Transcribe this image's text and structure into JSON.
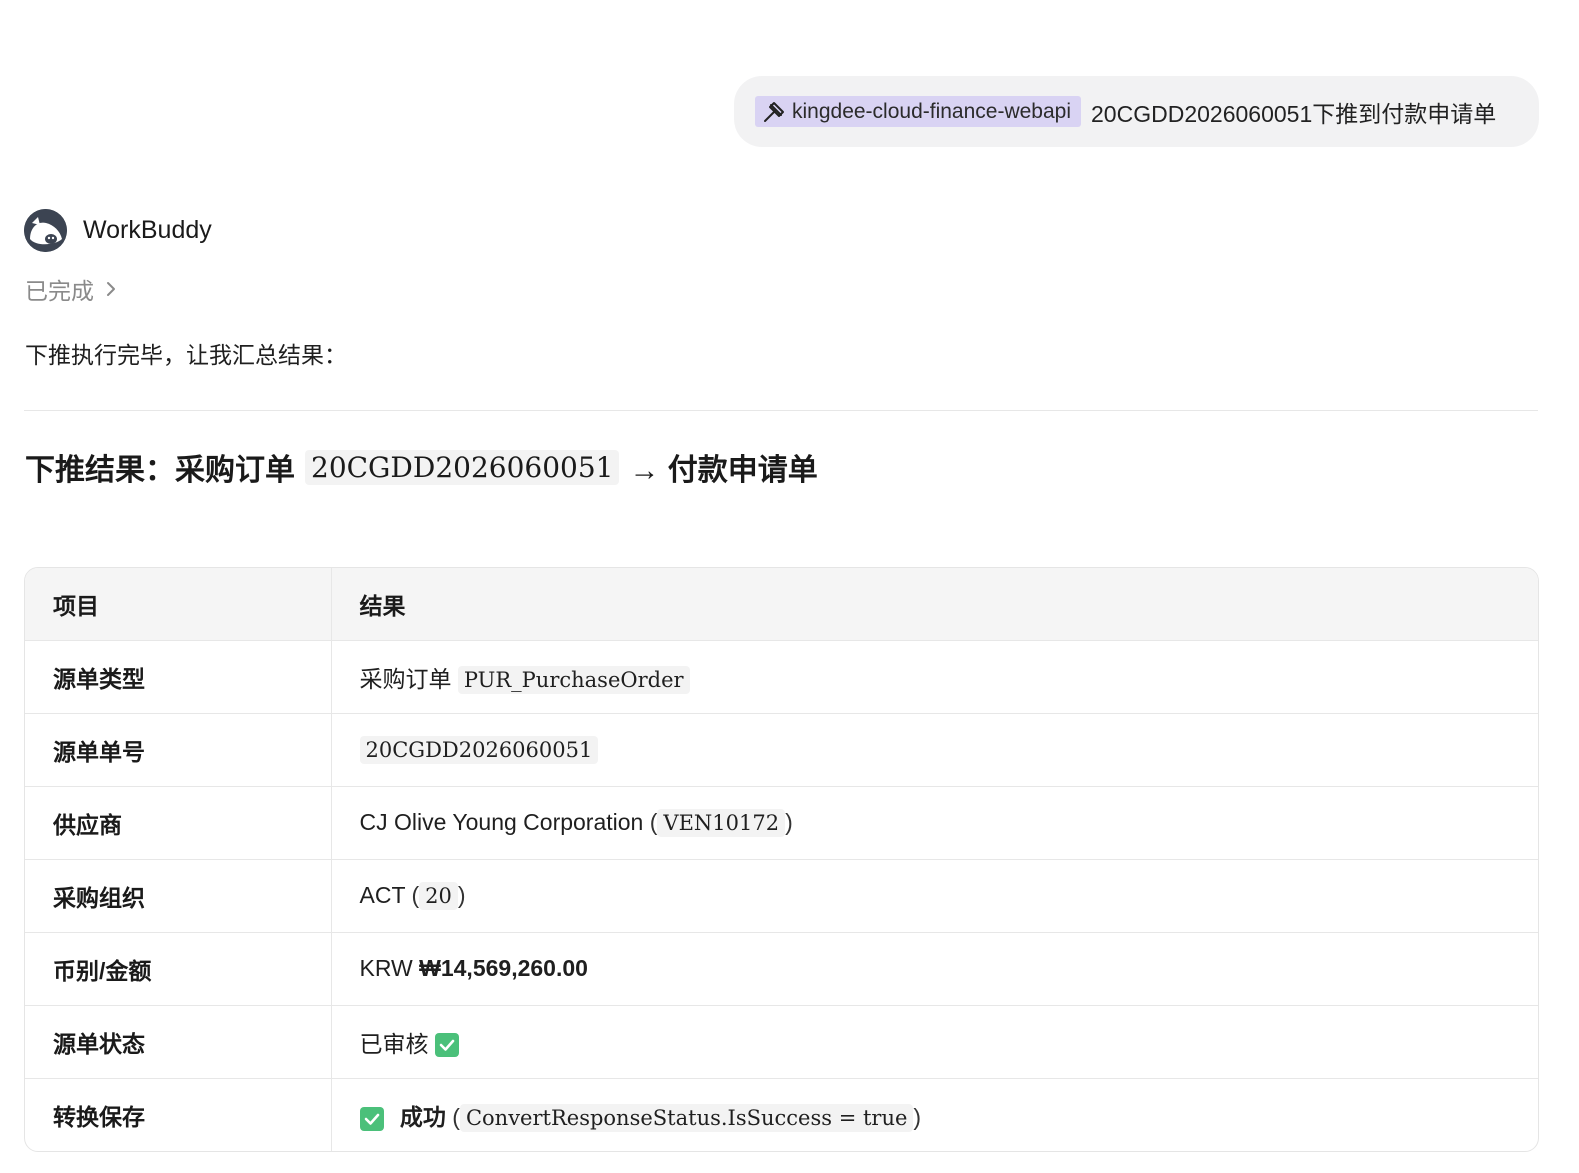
{
  "user_message": {
    "skill_name": "kingdee-cloud-finance-webapi",
    "text": "20CGDD2026060051下推到付款申请单"
  },
  "assistant": {
    "name": "WorkBuddy",
    "status": "已完成",
    "intro": "下推执行完毕，让我汇总结果："
  },
  "result": {
    "title_prefix": "下推结果：采购订单",
    "order_no": "20CGDD2026060051",
    "title_suffix": "→ 付款申请单"
  },
  "table": {
    "headers": [
      "项目",
      "结果"
    ],
    "rows": {
      "source_type": {
        "label": "源单类型",
        "value": "采购订单",
        "code": "PUR_PurchaseOrder"
      },
      "source_no": {
        "label": "源单单号",
        "code": "20CGDD2026060051"
      },
      "supplier": {
        "label": "供应商",
        "value": "CJ Olive Young Corporation",
        "code": "VEN10172"
      },
      "purchase_org": {
        "label": "采购组织",
        "value": "ACT",
        "code": "20"
      },
      "currency_amount": {
        "label": "币别/金额",
        "currency": "KRW",
        "amount": "₩14,569,260.00"
      },
      "source_status": {
        "label": "源单状态",
        "value": "已审核"
      },
      "convert_save": {
        "label": "转换保存",
        "value": "成功",
        "code": "ConvertResponseStatus.IsSuccess = true"
      }
    }
  },
  "colors": {
    "chip_bg": "#d9d3f3",
    "bubble_bg": "#f2f2f3",
    "check_green": "#4bc07a"
  }
}
